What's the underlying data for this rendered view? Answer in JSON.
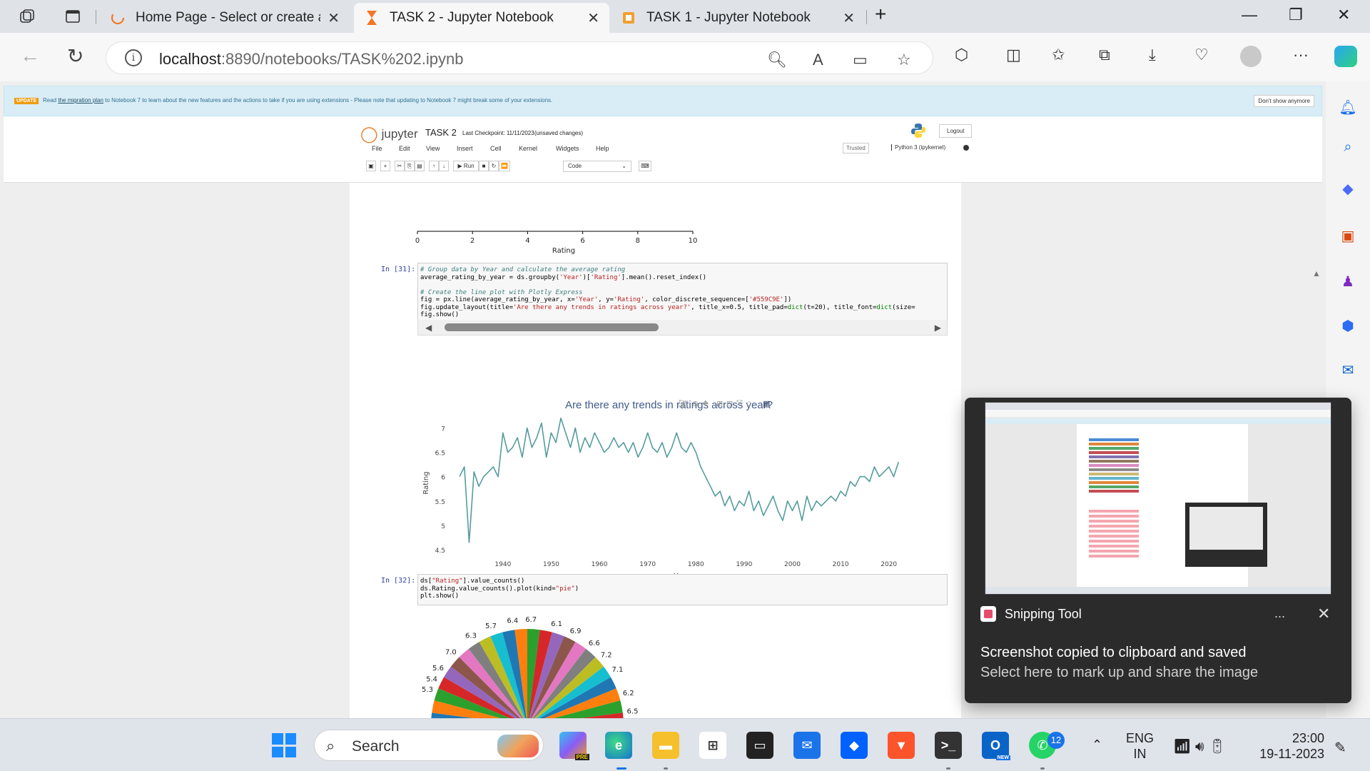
{
  "browser": {
    "tabs": [
      {
        "title": "Home Page - Select or create a n",
        "active": false
      },
      {
        "title": "TASK 2 - Jupyter Notebook",
        "active": true
      },
      {
        "title": "TASK 1 - Jupyter Notebook",
        "active": false
      }
    ],
    "url_host": "localhost",
    "url_rest": ":8890/notebooks/TASK%202.ipynb"
  },
  "banner": {
    "badge": "UPDATE",
    "text_before": "Read ",
    "link": "the migration plan",
    "text_after": " to Notebook 7 to learn about the new features and the actions to take if you are using extensions - Please note that updating to Notebook 7 might break some of your extensions.",
    "dismiss": "Don't show anymore"
  },
  "jupyter": {
    "logo": "jupyter",
    "notebook_name": "TASK 2",
    "checkpoint": "Last Checkpoint: 11/11/2023",
    "unsaved": "(unsaved changes)",
    "logout": "Logout",
    "menu": [
      "File",
      "Edit",
      "View",
      "Insert",
      "Cell",
      "Kernel",
      "Widgets",
      "Help"
    ],
    "trusted": "Trusted",
    "kernel": "Python 3 (ipykernel)",
    "run_label": "Run",
    "cell_type": "Code"
  },
  "prev_axis": {
    "ticks": [
      "0",
      "2",
      "4",
      "6",
      "8",
      "10"
    ],
    "label": "Rating"
  },
  "cells": [
    {
      "prompt": "In [31]:",
      "lines": [
        "# Group data by Year and calculate the average rating",
        "average_rating_by_year = ds.groupby('Year')['Rating'].mean().reset_index()",
        "",
        "# Create the line plot with Plotly Express",
        "fig = px.line(average_rating_by_year, x='Year', y='Rating', color_discrete_sequence=['#559C9E'])",
        "fig.update_layout(title='Are there any trends in ratings across year?', title_x=0.5, title_pad=dict(t=20), title_font=dict(size=",
        "fig.show()"
      ]
    },
    {
      "prompt": "In [32]:",
      "lines": [
        "ds[\"Rating\"].value_counts()",
        "ds.Rating.value_counts().plot(kind=\"pie\")",
        "plt.show()"
      ]
    }
  ],
  "chart_data": [
    {
      "type": "line",
      "title": "Are there any trends in ratings across year?",
      "xlabel": "Year",
      "ylabel": "Rating",
      "color": "#559C9E",
      "xlim": [
        1931,
        2023
      ],
      "ylim": [
        4.5,
        7.3
      ],
      "x_ticks": [
        1940,
        1950,
        1960,
        1970,
        1980,
        1990,
        2000,
        2010,
        2020
      ],
      "y_ticks": [
        "4.5",
        "5",
        "5.5",
        "6",
        "6.5",
        "7"
      ],
      "x": [
        1931,
        1932,
        1933,
        1934,
        1935,
        1936,
        1937,
        1938,
        1939,
        1940,
        1941,
        1942,
        1943,
        1944,
        1945,
        1946,
        1947,
        1948,
        1949,
        1950,
        1951,
        1952,
        1953,
        1954,
        1955,
        1956,
        1957,
        1958,
        1959,
        1960,
        1961,
        1962,
        1963,
        1964,
        1965,
        1966,
        1967,
        1968,
        1969,
        1970,
        1971,
        1972,
        1973,
        1974,
        1975,
        1976,
        1977,
        1978,
        1979,
        1980,
        1981,
        1982,
        1983,
        1984,
        1985,
        1986,
        1987,
        1988,
        1989,
        1990,
        1991,
        1992,
        1993,
        1994,
        1995,
        1996,
        1997,
        1998,
        1999,
        2000,
        2001,
        2002,
        2003,
        2004,
        2005,
        2006,
        2007,
        2008,
        2009,
        2010,
        2011,
        2012,
        2013,
        2014,
        2015,
        2016,
        2017,
        2018,
        2019,
        2020,
        2021,
        2022
      ],
      "y": [
        6.0,
        6.2,
        4.65,
        6.1,
        5.8,
        6.0,
        6.1,
        6.2,
        6.0,
        6.9,
        6.5,
        6.6,
        6.8,
        6.4,
        7.0,
        6.6,
        6.8,
        7.1,
        6.4,
        6.9,
        6.7,
        7.2,
        6.9,
        6.6,
        7.0,
        6.5,
        6.8,
        6.6,
        6.9,
        6.7,
        6.5,
        6.6,
        6.8,
        6.6,
        6.7,
        6.5,
        6.7,
        6.4,
        6.6,
        6.9,
        6.6,
        6.5,
        6.7,
        6.4,
        6.6,
        6.9,
        6.6,
        6.5,
        6.7,
        6.5,
        6.2,
        6.0,
        5.8,
        5.6,
        5.7,
        5.4,
        5.6,
        5.3,
        5.5,
        5.4,
        5.7,
        5.3,
        5.5,
        5.2,
        5.4,
        5.6,
        5.3,
        5.1,
        5.5,
        5.3,
        5.5,
        5.1,
        5.6,
        5.3,
        5.5,
        5.4,
        5.5,
        5.6,
        5.5,
        5.7,
        5.6,
        5.9,
        5.8,
        6.0,
        6.0,
        5.9,
        6.2,
        6.0,
        6.1,
        6.2,
        6.0,
        6.3
      ]
    },
    {
      "type": "pie",
      "labels_visible": [
        "5.3",
        "5.4",
        "5.6",
        "7.0",
        "6.3",
        "5.7",
        "6.4",
        "6.7",
        "6.1",
        "6.9",
        "6.6",
        "7.2",
        "7.1",
        "6.2",
        "6.5"
      ],
      "colors": [
        "#1f77b4",
        "#ff7f0e",
        "#2ca02c",
        "#d62728",
        "#9467bd",
        "#8c564b",
        "#e377c2",
        "#7f7f7f",
        "#bcbd22",
        "#17becf"
      ]
    }
  ],
  "toast": {
    "app": "Snipping Tool",
    "more": "...",
    "title": "Screenshot copied to clipboard and saved",
    "subtitle": "Select here to mark up and share the image"
  },
  "taskbar": {
    "search": "Search",
    "badge": "12",
    "lang_top": "ENG",
    "lang_bottom": "IN",
    "time": "23:00",
    "date": "19-11-2023",
    "pre_label": "PRE",
    "new_label": "NEW"
  }
}
